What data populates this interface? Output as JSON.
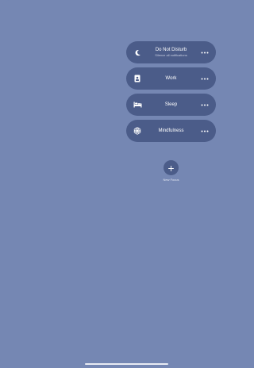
{
  "focus_modes": [
    {
      "name": "Do Not Disturb",
      "subtitle": "Silence all notifications",
      "icon": "moon-icon"
    },
    {
      "name": "Work",
      "subtitle": "",
      "icon": "id-badge-icon"
    },
    {
      "name": "Sleep",
      "subtitle": "",
      "icon": "bed-icon"
    },
    {
      "name": "Mindfulness",
      "subtitle": "",
      "icon": "flower-icon"
    }
  ],
  "more_icon": "ellipsis-icon",
  "new_focus": {
    "label": "New Focus",
    "icon": "plus-icon"
  },
  "colors": {
    "background": "#7587b3",
    "row_background": "#4b5c89",
    "text": "#ffffff"
  }
}
